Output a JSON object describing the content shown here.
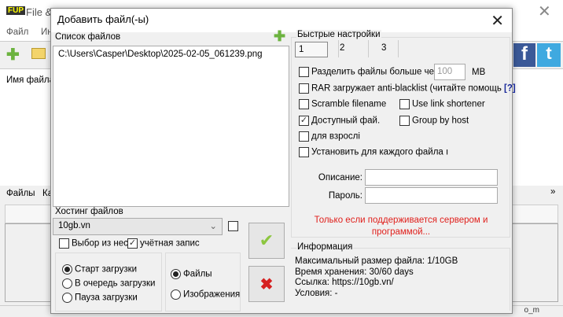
{
  "bg": {
    "title": "File &",
    "menu": [
      "Файл",
      "Ин"
    ],
    "list_header": "Имя файла",
    "tabs": [
      "Файлы",
      "Ка"
    ],
    "status": "o_m"
  },
  "dialog": {
    "title": "Добавить файл(-ы)",
    "files_label": "Список файлов",
    "files": [
      "C:\\Users\\Casper\\Desktop\\2025-02-05_061239.png"
    ],
    "hosting_label": "Хостинг файлов",
    "hosting_value": "10gb.vn",
    "choose_from": "Выбор из нес",
    "account": "учётная запис",
    "start_options": [
      "Старт загрузки",
      "В очередь загрузки",
      "Пауза загрузки"
    ],
    "type_options": [
      "Файлы",
      "Изображения"
    ],
    "quick_settings": "Быстрые настройки",
    "tabs": [
      "1",
      "2",
      "3"
    ],
    "split_label": "Разделить файлы больше че",
    "split_value": "100",
    "split_unit": "MB",
    "rar_label": "RAR загружает anti-blacklist (читайте помощь",
    "help": "[?]",
    "scramble": "Scramble filename",
    "shortener": "Use link shortener",
    "available": "Доступный фай.",
    "group_host": "Group by host",
    "adult": "для взрослі",
    "each_file": "Установить для каждого файла ı",
    "desc_label": "Описание:",
    "pass_label": "Пароль:",
    "warning": "Только если поддерживается сервером и программой...",
    "info_label": "Информация",
    "info": [
      "Максимальный размер файла: 1/10GB",
      "Время хранения: 30/60 days",
      "Ссылка: https://10gb.vn/",
      "Условия: -"
    ]
  },
  "colors": {
    "warning": "#e0201c",
    "help": "#1a2a9a",
    "accent_green": "#6cb33f"
  }
}
